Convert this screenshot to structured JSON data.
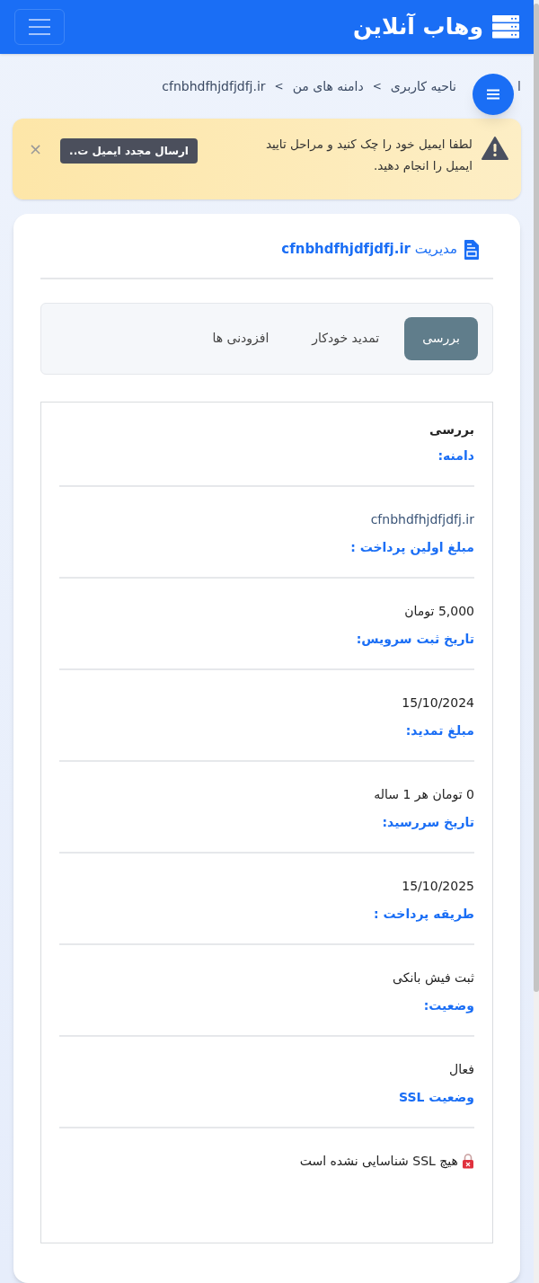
{
  "header": {
    "title": "وهاب آنلاین"
  },
  "breadcrumb": [
    "ا",
    "ناحیه کاربری",
    "دامنه های من",
    "cfnbhdfhjdfjdfj.ir"
  ],
  "breadcrumb_separator": ">",
  "alert": {
    "message": "لطفا ایمیل خود را چک کنید و مراحل تایید ایمیل را انجام دهید.",
    "button": "ارسال مجدد ایمیل ت..",
    "close": "×"
  },
  "card": {
    "title_prefix": "مدیریت",
    "title_domain": "cfnbhdfhjdfjdfj.ir"
  },
  "tabs": [
    {
      "label": "بررسی",
      "selected": true
    },
    {
      "label": "تمدید خودکار",
      "selected": false
    },
    {
      "label": "افزودنی ها",
      "selected": false
    }
  ],
  "panel": {
    "title": "بررسی",
    "sections": [
      {
        "label": "دامنه:"
      },
      {
        "value": "cfnbhdfhjdfjdfj.ir",
        "kind": "link",
        "label": "مبلغ اولین پرداخت :"
      },
      {
        "value": "5,000 تومان",
        "kind": "text",
        "label": "تاریخ ثبت سرویس:"
      },
      {
        "value": "15/10/2024",
        "kind": "text",
        "label": "مبلغ تمدید:"
      },
      {
        "value": "0 تومان هر 1 ساله",
        "kind": "text",
        "label": "تاریخ سررسید:"
      },
      {
        "value": "15/10/2025",
        "kind": "text",
        "label": "طریقه پرداخت :"
      },
      {
        "value": "ثبت فیش بانکی",
        "kind": "text",
        "label": "وضعیت:"
      },
      {
        "value": "فعال",
        "kind": "text",
        "label": "وضعیت SSL"
      },
      {
        "value": "هیچ SSL شناسایی نشده است",
        "kind": "ssl"
      }
    ]
  }
}
